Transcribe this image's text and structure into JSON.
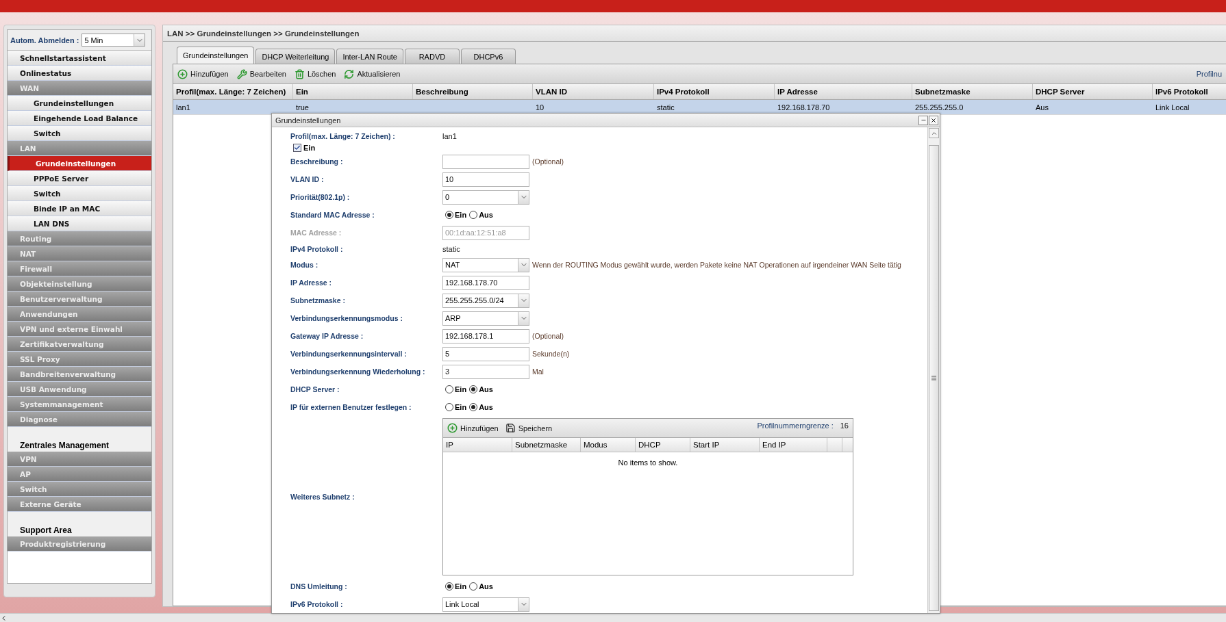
{
  "logout": {
    "label": "Autom. Abmelden :",
    "value": "5 Min"
  },
  "sidebar": {
    "items": [
      {
        "kind": "item",
        "label": "Schnellstartassistent",
        "selected": false
      },
      {
        "kind": "item",
        "label": "Onlinestatus",
        "selected": false
      },
      {
        "kind": "group",
        "label": "WAN",
        "selected": false,
        "children": [
          {
            "kind": "item",
            "label": "Grundeinstellungen",
            "selected": false
          },
          {
            "kind": "item",
            "label": "Eingehende Load Balance",
            "selected": false
          },
          {
            "kind": "item",
            "label": "Switch",
            "selected": false
          }
        ]
      },
      {
        "kind": "group",
        "label": "LAN",
        "selected": false,
        "children": [
          {
            "kind": "item",
            "label": "Grundeinstellungen",
            "selected": true
          },
          {
            "kind": "item",
            "label": "PPPoE Server",
            "selected": false
          },
          {
            "kind": "item",
            "label": "Switch",
            "selected": false
          },
          {
            "kind": "item",
            "label": "Binde IP an MAC",
            "selected": false
          },
          {
            "kind": "item",
            "label": "LAN DNS",
            "selected": false
          }
        ]
      },
      {
        "kind": "group",
        "label": "Routing",
        "selected": false
      },
      {
        "kind": "group",
        "label": "NAT",
        "selected": false
      },
      {
        "kind": "group",
        "label": "Firewall",
        "selected": false
      },
      {
        "kind": "group",
        "label": "Objekteinstellung",
        "selected": false
      },
      {
        "kind": "group",
        "label": "Benutzerverwaltung",
        "selected": false
      },
      {
        "kind": "group",
        "label": "Anwendungen",
        "selected": false
      },
      {
        "kind": "group",
        "label": "VPN und externe Einwahl",
        "selected": false
      },
      {
        "kind": "group",
        "label": "Zertifikatverwaltung",
        "selected": false
      },
      {
        "kind": "group",
        "label": "SSL Proxy",
        "selected": false
      },
      {
        "kind": "group",
        "label": "Bandbreitenverwaltung",
        "selected": false
      },
      {
        "kind": "group",
        "label": "USB Anwendung",
        "selected": false
      },
      {
        "kind": "group",
        "label": "Systemmanagement",
        "selected": false
      },
      {
        "kind": "group",
        "label": "Diagnose",
        "selected": false
      },
      {
        "kind": "section",
        "label": "Zentrales Management"
      },
      {
        "kind": "group",
        "label": "VPN",
        "selected": false
      },
      {
        "kind": "group",
        "label": "AP",
        "selected": false
      },
      {
        "kind": "group",
        "label": "Switch",
        "selected": false
      },
      {
        "kind": "group",
        "label": "Externe Geräte",
        "selected": false
      },
      {
        "kind": "section",
        "label": "Support Area"
      },
      {
        "kind": "group",
        "label": "Produktregistrierung",
        "selected": false
      }
    ]
  },
  "breadcrumb": "LAN >> Grundeinstellungen >> Grundeinstellungen",
  "tabs": [
    {
      "label": "Grundeinstellungen",
      "selected": true
    },
    {
      "label": "DHCP Weiterleitung",
      "selected": false
    },
    {
      "label": "Inter-LAN Route",
      "selected": false
    },
    {
      "label": "RADVD",
      "selected": false
    },
    {
      "label": "DHCPv6",
      "selected": false
    }
  ],
  "toolbar": {
    "buttons": [
      {
        "kind": "add",
        "label": "Hinzufügen"
      },
      {
        "kind": "edit",
        "label": "Bearbeiten"
      },
      {
        "kind": "delete",
        "label": "Löschen"
      },
      {
        "kind": "refresh",
        "label": "Aktualisieren"
      }
    ],
    "limit_text": "Profilnu"
  },
  "table": {
    "columns": [
      "Profil(max. Länge: 7 Zeichen)",
      "Ein",
      "Beschreibung",
      "VLAN ID",
      "IPv4 Protokoll",
      "IP Adresse",
      "Subnetzmaske",
      "DHCP Server",
      "IPv6 Protokoll"
    ],
    "rows": [
      {
        "selected": true,
        "cells": [
          "lan1",
          "true",
          "",
          "10",
          "static",
          "192.168.178.70",
          "255.255.255.0",
          "Aus",
          "Link Local"
        ]
      }
    ]
  },
  "dialog": {
    "title": "Grundeinstellungen",
    "fields": [
      {
        "kind": "static",
        "label": "Profil(max. Länge: 7 Zeichen) :",
        "value": "lan1"
      },
      {
        "kind": "checkbox",
        "label": "Ein",
        "checked": true
      },
      {
        "kind": "input",
        "label": "Beschreibung :",
        "hint": "(Optional)",
        "disabled": false
      },
      {
        "kind": "input",
        "label": "VLAN ID :",
        "value": "10",
        "disabled": false
      },
      {
        "kind": "select",
        "label": "Priorität(802.1p) :",
        "value": "0"
      },
      {
        "kind": "radio",
        "label": "Standard MAC Adresse :",
        "options": [
          {
            "label": "Ein",
            "selected": true
          },
          {
            "label": "Aus",
            "selected": false
          }
        ]
      },
      {
        "kind": "input",
        "label": "MAC Adresse :",
        "value": "00:1d:aa:12:51:a8",
        "disabled": true
      },
      {
        "kind": "static",
        "label": "IPv4 Protokoll :",
        "value": "static"
      },
      {
        "kind": "select",
        "label": "Modus :",
        "value": "NAT",
        "hint": "Wenn der ROUTING Modus gewählt wurde,   werden Pakete keine NAT Operationen auf irgendeiner WAN Seite tätig"
      },
      {
        "kind": "input",
        "label": "IP Adresse :",
        "value": "192.168.178.70",
        "disabled": false
      },
      {
        "kind": "select",
        "label": "Subnetzmaske :",
        "value": "255.255.255.0/24"
      },
      {
        "kind": "select",
        "label": "Verbindungserkennungsmodus :",
        "value": "ARP"
      },
      {
        "kind": "input",
        "label": "Gateway IP Adresse :",
        "value": "192.168.178.1",
        "hint": "(Optional)",
        "disabled": false
      },
      {
        "kind": "input",
        "label": "Verbindungserkennungsintervall :",
        "value": "5",
        "hint": "Sekunde(n)",
        "disabled": false
      },
      {
        "kind": "input",
        "label": "Verbindungserkennung Wiederholung :",
        "value": "3",
        "hint": "Mal",
        "disabled": false
      },
      {
        "kind": "radio",
        "label": "DHCP Server :",
        "options": [
          {
            "label": "Ein",
            "selected": false
          },
          {
            "label": "Aus",
            "selected": true
          }
        ]
      },
      {
        "kind": "radio",
        "label": "IP für externen Benutzer festlegen :",
        "options": [
          {
            "label": "Ein",
            "selected": false
          },
          {
            "label": "Aus",
            "selected": true
          }
        ]
      },
      {
        "kind": "grid",
        "label": "Weiteres Subnetz :",
        "buttons": [
          {
            "kind": "add",
            "label": "Hinzufügen"
          },
          {
            "kind": "save",
            "label": "Speichern"
          }
        ],
        "limit_label": "Profilnummerngrenze :",
        "limit_value": "16",
        "columns": [
          "IP",
          "Subnetzmaske",
          "Modus",
          "DHCP",
          "Start IP",
          "End IP"
        ],
        "empty_text": "No items to show."
      },
      {
        "kind": "radio",
        "label": "DNS Umleitung :",
        "options": [
          {
            "label": "Ein",
            "selected": true
          },
          {
            "label": "Aus",
            "selected": false
          }
        ]
      },
      {
        "kind": "select",
        "label": "IPv6 Protokoll :",
        "value": "Link Local"
      }
    ]
  }
}
